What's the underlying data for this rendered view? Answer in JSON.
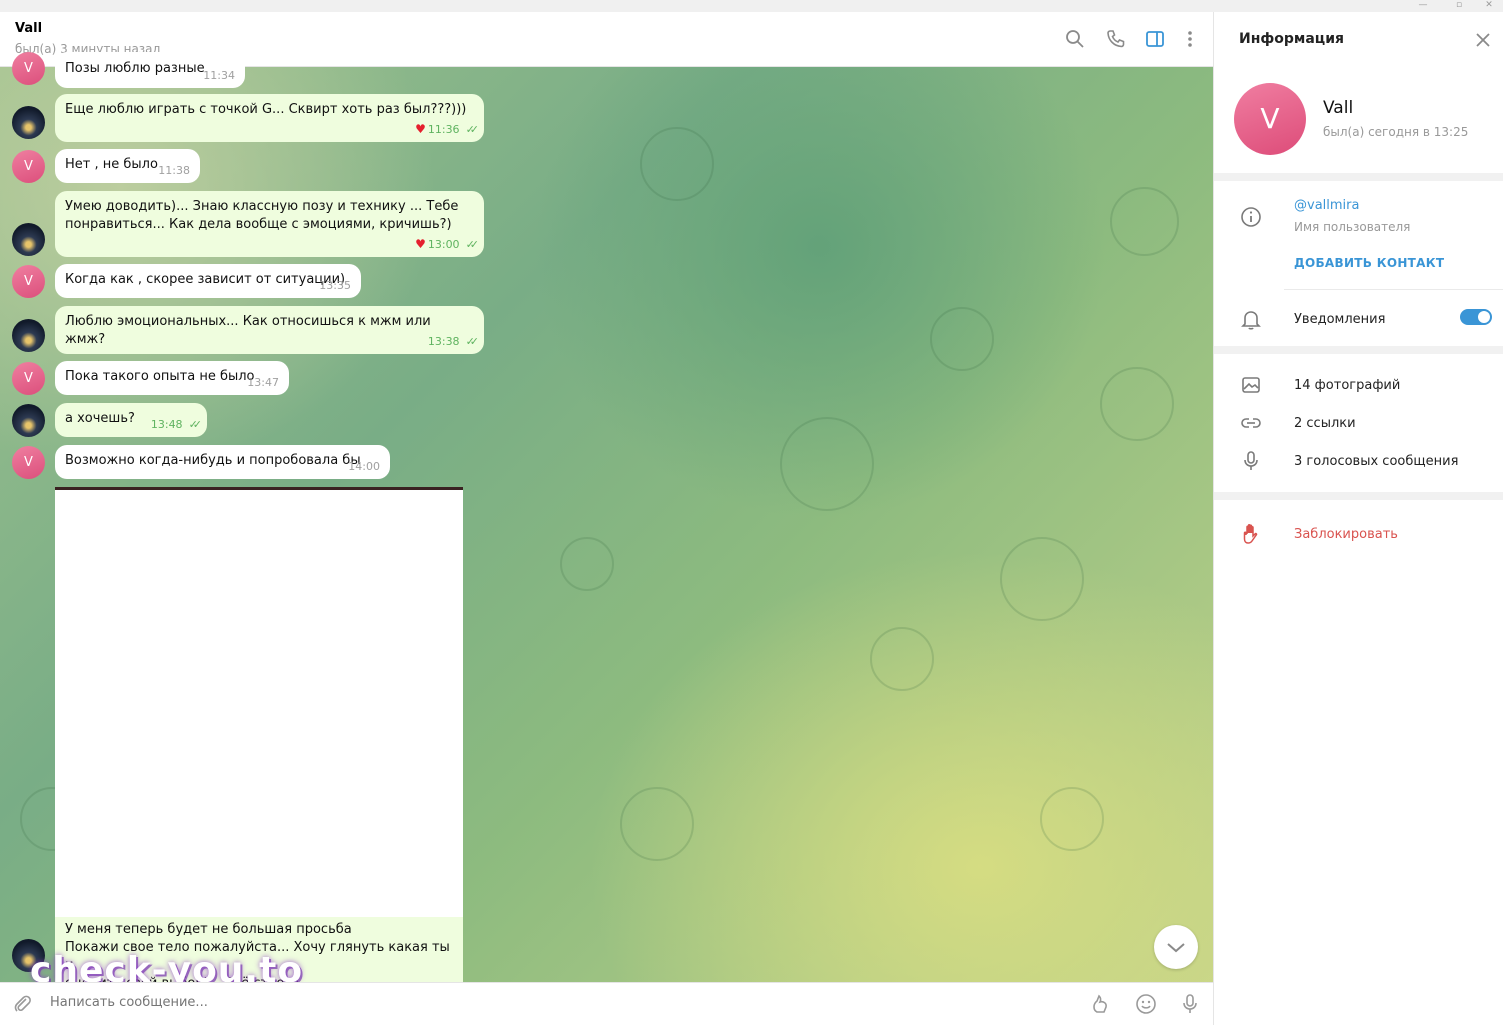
{
  "chat": {
    "name": "Vall",
    "status": "был(а) 3 минуты назад",
    "composer_placeholder": "Написать сообщение..."
  },
  "messages": [
    {
      "id": 0,
      "sender": "them",
      "avatar_letter": "V",
      "text": "Позы люблю разные",
      "time": "11:34"
    },
    {
      "id": 1,
      "sender": "me",
      "text": "Еще люблю играть с точкой G... Сквирт хоть раз был???)))",
      "time": "11:36",
      "reaction": "♥",
      "read": true
    },
    {
      "id": 2,
      "sender": "them",
      "avatar_letter": "V",
      "text": "Нет , не было",
      "time": "11:38"
    },
    {
      "id": 3,
      "sender": "me",
      "text": "Умею доводить)... Знаю классную позу и технику ... Тебе понравиться... Как дела вообще с эмоциями, кричишь?)",
      "time": "13:00",
      "reaction": "♥",
      "read": true
    },
    {
      "id": 4,
      "sender": "them",
      "avatar_letter": "V",
      "text": "Когда как , скорее зависит от ситуации)",
      "time": "13:35"
    },
    {
      "id": 5,
      "sender": "me",
      "text": "Люблю эмоциональных... Как относишься к мжм или жмж?",
      "time": "13:38",
      "read": true
    },
    {
      "id": 6,
      "sender": "them",
      "avatar_letter": "V",
      "text": "Пока такого опыта не было",
      "time": "13:47"
    },
    {
      "id": 7,
      "sender": "me",
      "text": "а хочешь?",
      "time": "13:48",
      "read": true
    },
    {
      "id": 8,
      "sender": "them",
      "avatar_letter": "V",
      "text": "Возможно когда-нибудь и попробовала бы",
      "time": "14:00"
    },
    {
      "id": 9,
      "sender": "me",
      "lines": [
        "У меня теперь будет не большая просьба",
        "Покажи свое тело пожалуйста... Хочу глянуть какая ты и",
        "оценить свой выбор)... Всё строго конфиденциально!!!...В этом"
      ]
    }
  ],
  "watermark": "check-you.to",
  "info": {
    "title": "Информация",
    "avatar_letter": "V",
    "name": "Vall",
    "status": "был(а) сегодня в 13:25",
    "username": "@vallmira",
    "username_label": "Имя пользователя",
    "add_contact": "ДОБАВИТЬ КОНТАКТ",
    "notifications": "Уведомления",
    "notifications_on": true,
    "photos": "14 фотографий",
    "links": "2 ссылки",
    "voice": "3 голосовых сообщения",
    "block": "Заблокировать"
  },
  "colors": {
    "accent": "#3a95d6",
    "outgoing_bubble": "#effdde",
    "read_check": "#5fb360",
    "danger": "#d9534f",
    "avatar_pink": "#e0557f"
  },
  "icons": [
    "search-icon",
    "phone-icon",
    "sidebar-toggle-icon",
    "more-icon",
    "close-icon",
    "info-icon",
    "bell-icon",
    "photo-icon",
    "link-icon",
    "mic-icon",
    "block-hand-icon",
    "attach-icon",
    "bot-commands-icon",
    "emoji-icon",
    "chevron-down-icon"
  ]
}
